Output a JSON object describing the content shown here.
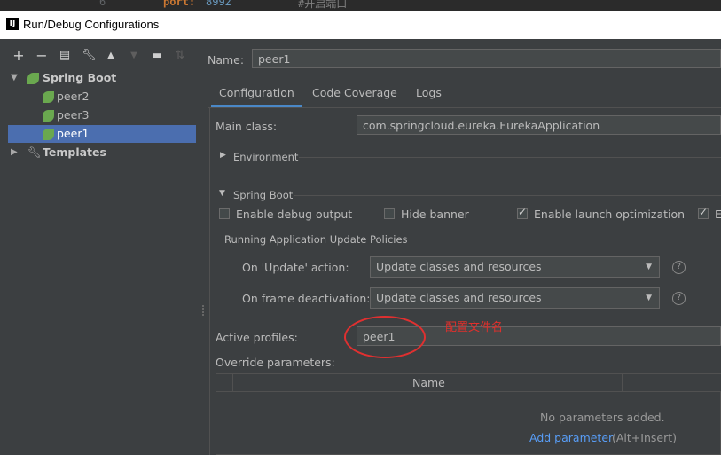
{
  "editor": {
    "line_no": "6",
    "code_key": "port:",
    "code_val": "8992",
    "code_comment": "#开启端口"
  },
  "window": {
    "icon_text": "IJ",
    "title": "Run/Debug Configurations"
  },
  "toolbar": {
    "items": [
      "add-icon",
      "remove-icon",
      "copy-icon",
      "wrench-icon",
      "arrow-up-icon",
      "arrow-down-icon",
      "folder-icon",
      "sort-icon"
    ]
  },
  "tree": {
    "spring_boot": "Spring Boot",
    "children": [
      "peer2",
      "peer3",
      "peer1"
    ],
    "templates": "Templates"
  },
  "name": {
    "label": "Name:",
    "value": "peer1"
  },
  "tabs": [
    "Configuration",
    "Code Coverage",
    "Logs"
  ],
  "main_class": {
    "label": "Main class:",
    "value": "com.springcloud.eureka.EurekaApplication"
  },
  "environment": "Environment",
  "spring_boot_section": "Spring Boot",
  "options": {
    "debug": "Enable debug output",
    "hide_banner": "Hide banner",
    "launch_opt": "Enable launch optimization",
    "cut": "E"
  },
  "update_policies": "Running Application Update Policies",
  "on_update": {
    "label": "On 'Update' action:",
    "value": "Update classes and resources"
  },
  "on_frame": {
    "label": "On frame deactivation:",
    "value": "Update classes and resources"
  },
  "active_profiles": {
    "label": "Active profiles:",
    "value": "peer1"
  },
  "annotation": "配置文件名",
  "override": {
    "label": "Override parameters:",
    "column": "Name",
    "empty": "No parameters added.",
    "add_link": "Add parameter",
    "shortcut": "(Alt+Insert)"
  },
  "colors": {
    "accent": "#4a88c7",
    "selection": "#4b6eaf",
    "annotation": "#e0302c",
    "link": "#589df6"
  }
}
